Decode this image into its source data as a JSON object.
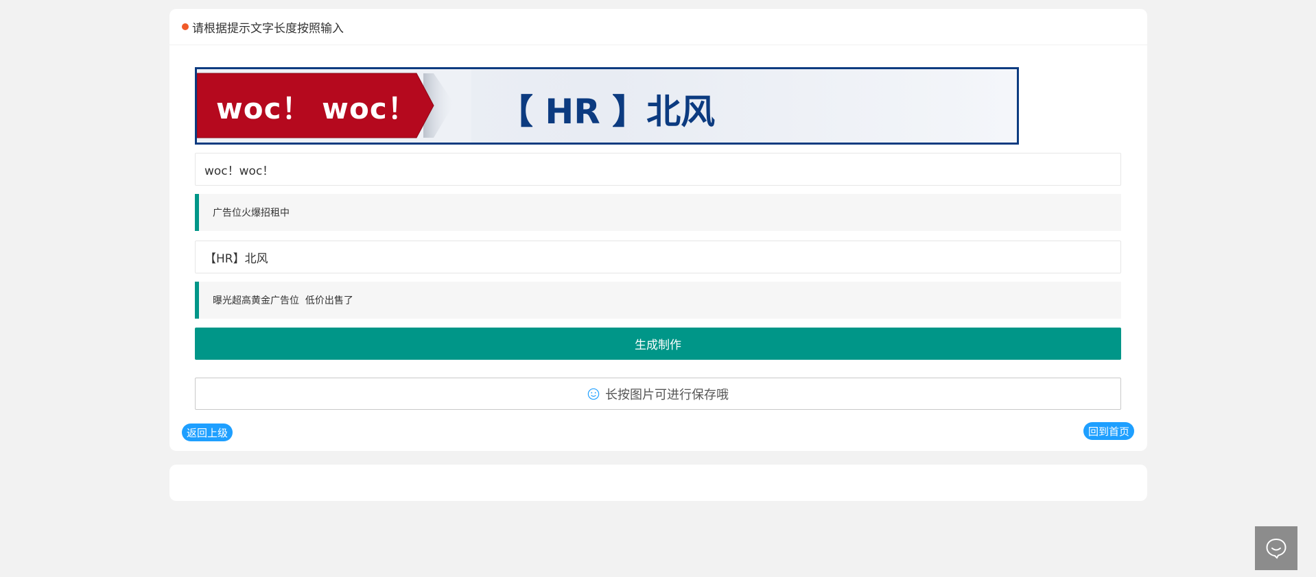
{
  "header": {
    "title": "请根据提示文字长度按照输入",
    "accent_color": "#f05a28"
  },
  "banner": {
    "left_text": "woc！ woc！",
    "right_text": "【 HR 】北风",
    "red_color": "#b5091e",
    "navy_color": "#0c3b80"
  },
  "form": {
    "field1_value": "woc！woc！",
    "tip1": "广告位火爆招租中",
    "field2_value": "【HR】北风",
    "tip2": "曝光超高黄金广告位  低价出售了",
    "generate_label": "生成制作",
    "save_hint": "长按图片可进行保存哦",
    "primary_color": "#009688"
  },
  "nav": {
    "back_label": "返回上级",
    "home_label": "回到首页",
    "pill_color": "#1e9fff"
  },
  "icons": {
    "smile": "smile-icon",
    "chat": "chat-bubble-icon"
  }
}
